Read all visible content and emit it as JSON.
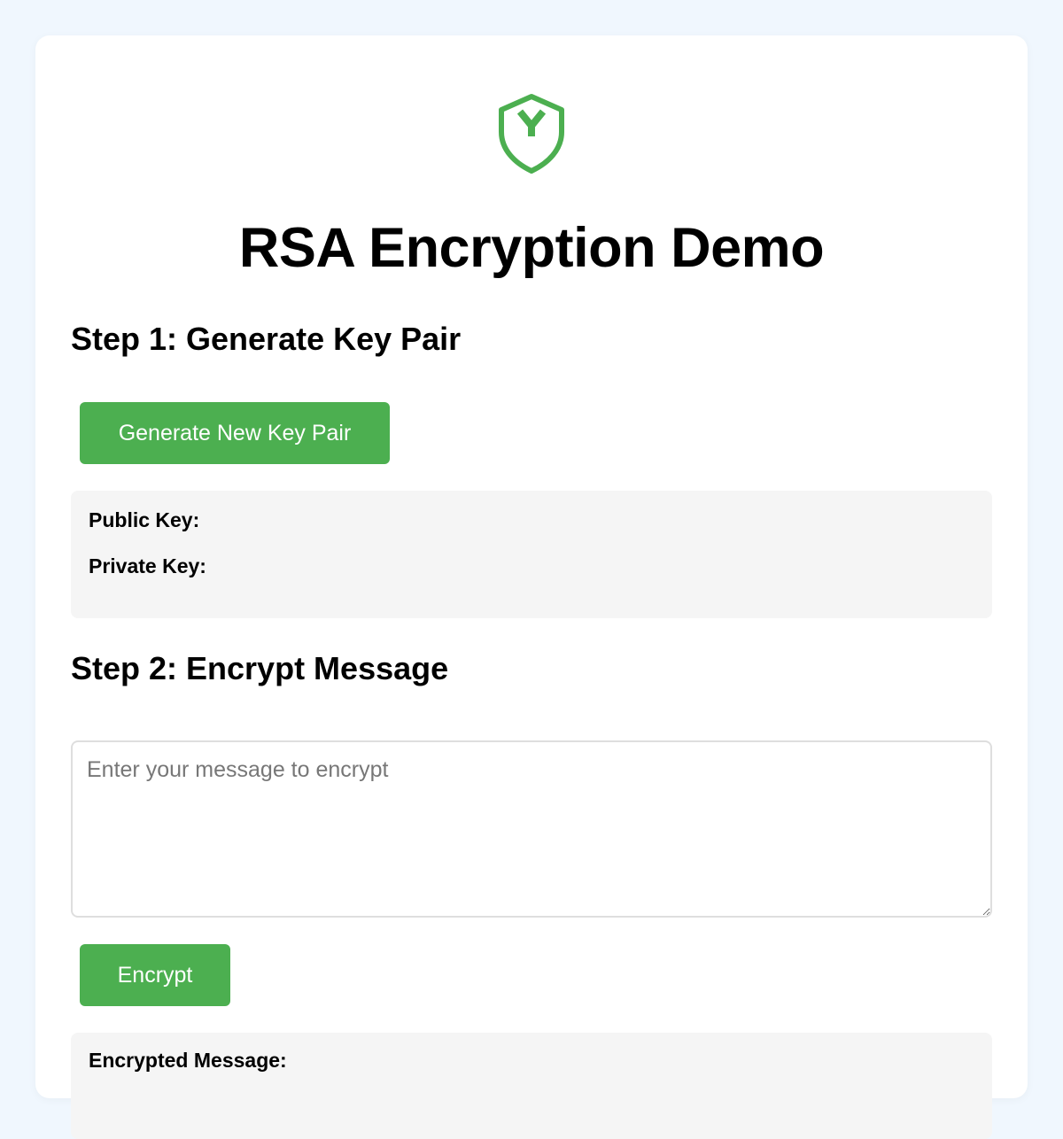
{
  "app": {
    "title": "RSA Encryption Demo",
    "logo_icon": "shield-icon",
    "accent_color": "#4caf50",
    "background_color": "#f0f7fe"
  },
  "step1": {
    "heading": "Step 1: Generate Key Pair",
    "generate_button_label": "Generate New Key Pair",
    "public_key_label": "Public Key:",
    "public_key_value": "",
    "private_key_label": "Private Key:",
    "private_key_value": ""
  },
  "step2": {
    "heading": "Step 2: Encrypt Message",
    "message_placeholder": "Enter your message to encrypt",
    "message_value": "",
    "encrypt_button_label": "Encrypt",
    "encrypted_label": "Encrypted Message:",
    "encrypted_value": ""
  }
}
